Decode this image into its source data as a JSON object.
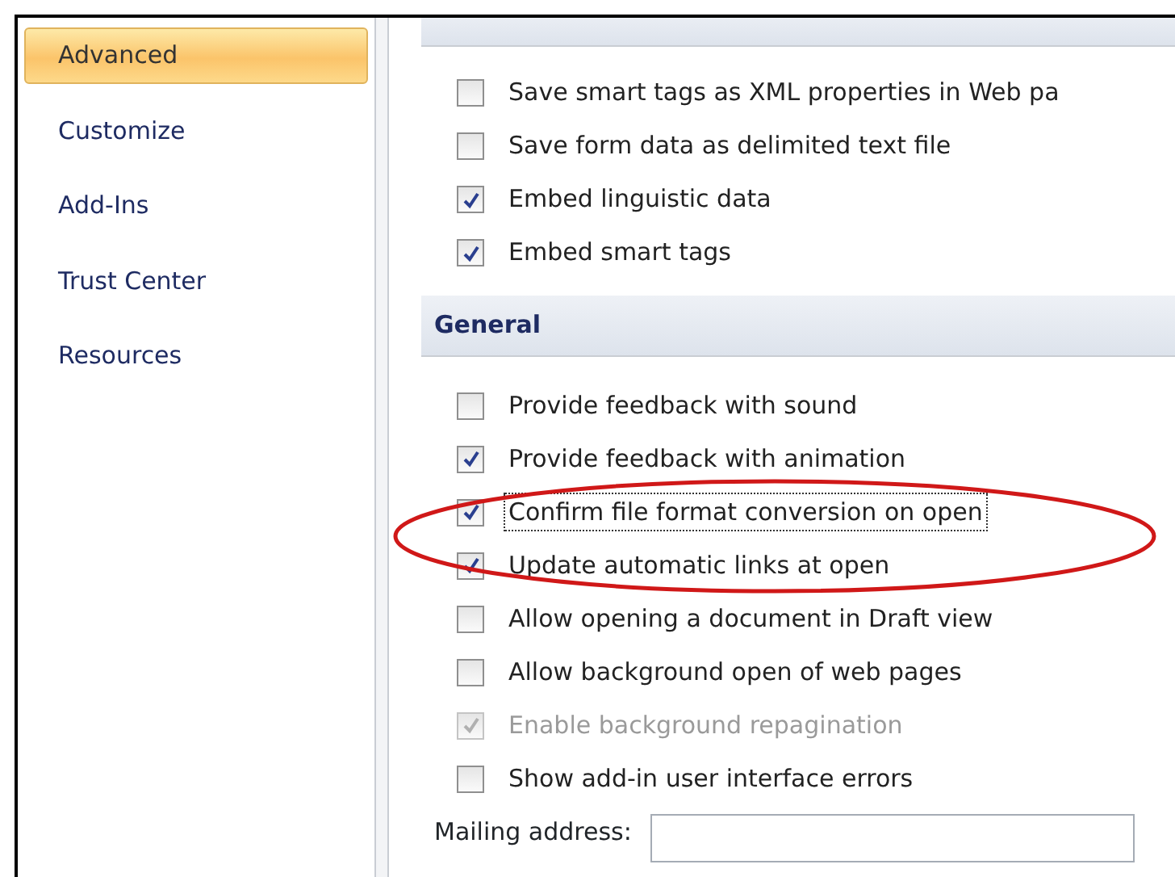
{
  "sidebar": {
    "items": [
      {
        "label": "Advanced",
        "selected": true
      },
      {
        "label": "Customize",
        "selected": false
      },
      {
        "label": "Add-Ins",
        "selected": false
      },
      {
        "label": "Trust Center",
        "selected": false
      },
      {
        "label": "Resources",
        "selected": false
      }
    ]
  },
  "sections": [
    {
      "options": [
        {
          "label": "Save smart tags as XML properties in Web pa",
          "checked": false,
          "disabled": false,
          "focused": false
        },
        {
          "label": "Save form data as delimited text file",
          "checked": false,
          "disabled": false,
          "focused": false
        },
        {
          "label": "Embed linguistic data",
          "checked": true,
          "disabled": false,
          "focused": false
        },
        {
          "label": "Embed smart tags",
          "checked": true,
          "disabled": false,
          "focused": false
        }
      ]
    },
    {
      "title": "General",
      "options": [
        {
          "label": "Provide feedback with sound",
          "checked": false,
          "disabled": false,
          "focused": false
        },
        {
          "label": "Provide feedback with animation",
          "checked": true,
          "disabled": false,
          "focused": false
        },
        {
          "label": "Confirm file format conversion on open",
          "checked": true,
          "disabled": false,
          "focused": true
        },
        {
          "label": "Update automatic links at open",
          "checked": true,
          "disabled": false,
          "focused": false
        },
        {
          "label": "Allow opening a document in Draft view",
          "checked": false,
          "disabled": false,
          "focused": false
        },
        {
          "label": "Allow background open of web pages",
          "checked": false,
          "disabled": false,
          "focused": false
        },
        {
          "label": "Enable background repagination",
          "checked": true,
          "disabled": true,
          "focused": false
        },
        {
          "label": "Show add-in user interface errors",
          "checked": false,
          "disabled": false,
          "focused": false
        }
      ],
      "field": {
        "label": "Mailing address:"
      }
    }
  ]
}
